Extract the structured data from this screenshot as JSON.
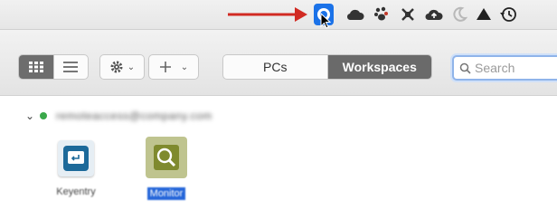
{
  "menubar": {
    "status_icons": [
      "vm-logo-icon",
      "cloud-icon",
      "paw-icon",
      "bug-icon",
      "upload-cloud-icon",
      "moon-icon",
      "eject-icon",
      "history-clock-icon"
    ],
    "active_icon": "vm-logo-icon",
    "arrow_color": "#d12a22"
  },
  "toolbar": {
    "view_modes": [
      "grid-view-icon",
      "list-view-icon"
    ],
    "selected_view": "grid-view-icon",
    "tabs": [
      {
        "label": "PCs",
        "selected": false
      },
      {
        "label": "Workspaces",
        "selected": true
      }
    ],
    "search": {
      "placeholder": "Search",
      "value": ""
    }
  },
  "content": {
    "group": {
      "name": "remoteaccess@company.com",
      "status_color": "#3aa84a"
    },
    "items": [
      {
        "label": "Keyentry",
        "icon": "keyentry-app-icon",
        "selected": false
      },
      {
        "label": "Monitor",
        "icon": "monitor-magnifier-icon",
        "selected": true
      }
    ]
  },
  "colors": {
    "accent": "#1b72e8",
    "selection": "#2566d9",
    "tab_selected": "#6a6a6a"
  }
}
